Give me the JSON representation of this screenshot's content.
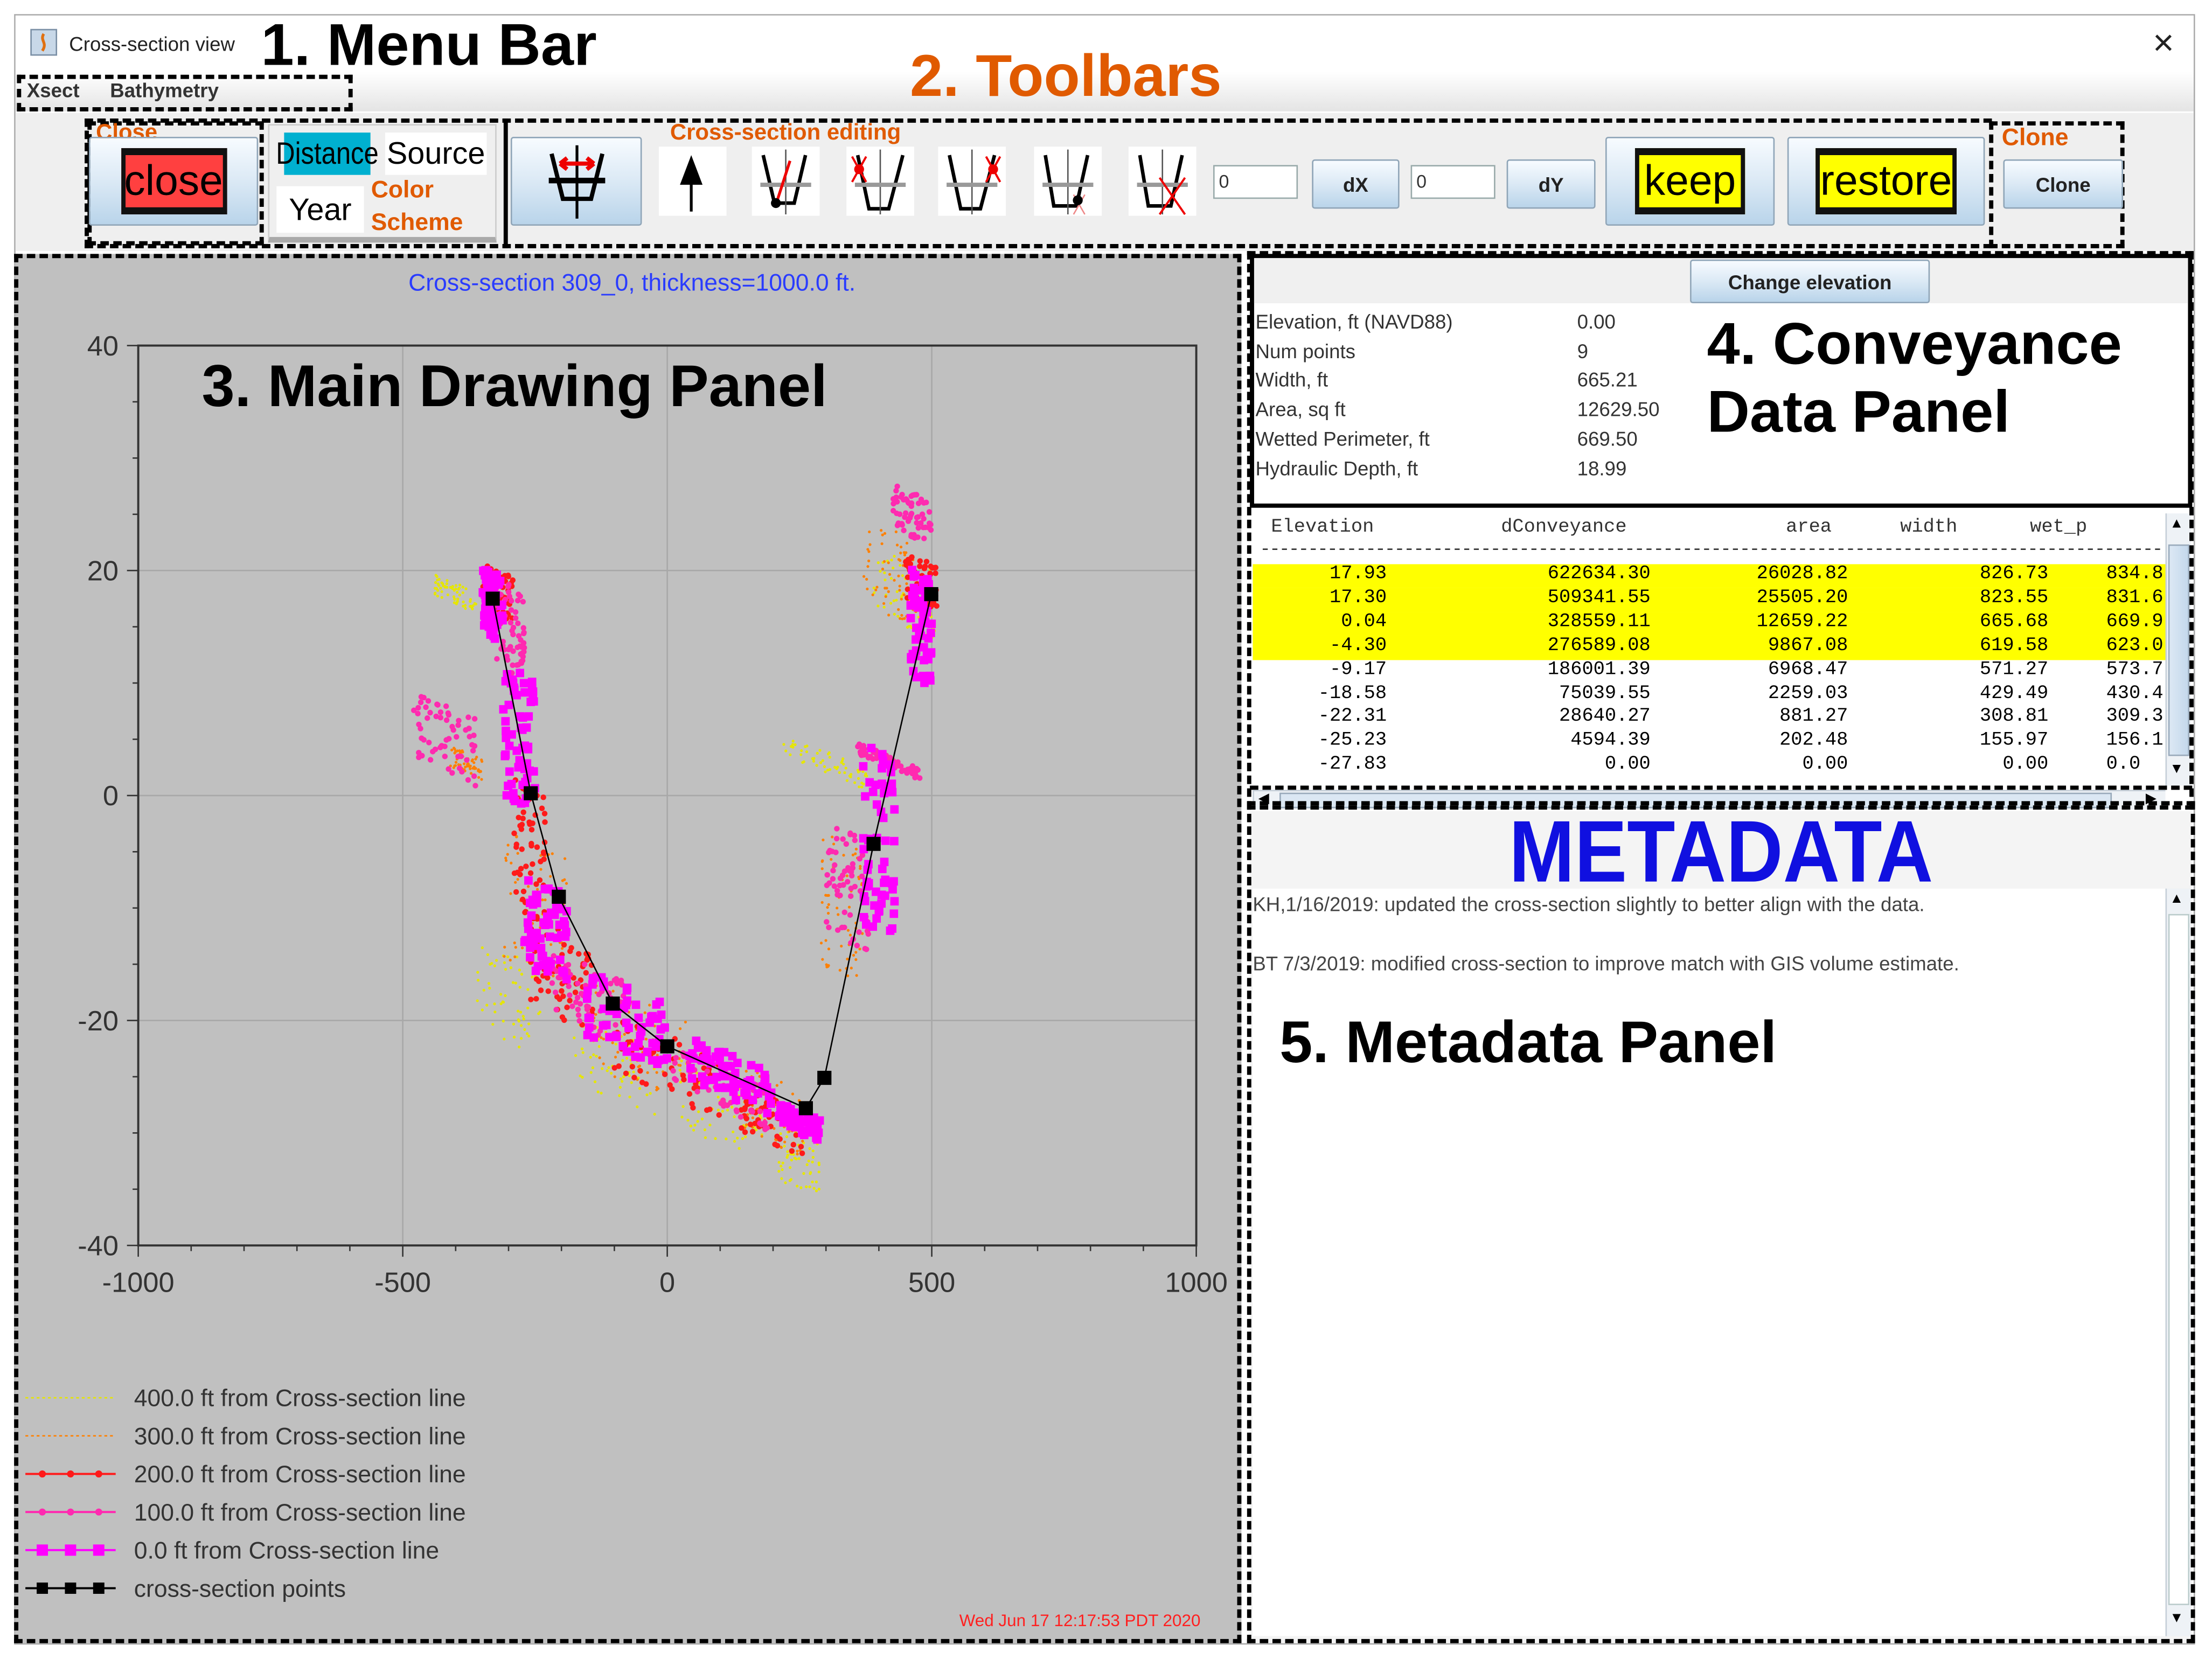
{
  "window": {
    "title": "Cross-section view",
    "close_glyph": "×"
  },
  "annotations": {
    "menu_bar": "1. Menu Bar",
    "toolbars": "2. Toolbars",
    "main_panel": "3. Main Drawing Panel",
    "conveyance_panel_1": "4. Conveyance",
    "conveyance_panel_2": "Data Panel",
    "metadata_panel": "5. Metadata Panel",
    "close_group": "Close",
    "color_scheme_1": "Color",
    "color_scheme_2": "Scheme",
    "editing_group": "Cross-section editing",
    "clone_group": "Clone"
  },
  "menu": {
    "items": [
      "Xsect",
      "Bathymetry"
    ]
  },
  "toolbar": {
    "close_label": "close",
    "color_distance": "Distance",
    "color_source": "Source",
    "color_year": "Year",
    "dx_value": "0",
    "dx_label": "dX",
    "dy_value": "0",
    "dy_label": "dY",
    "keep_label": "keep",
    "restore_label": "restore",
    "clone_label": "Clone",
    "edit_icons": [
      "move-up-icon",
      "move-point-icon",
      "delete-left-point-icon",
      "delete-right-point-icon",
      "insert-point-icon",
      "delete-point-icon"
    ]
  },
  "main": {
    "timestamp": "Wed Jun 17 12:17:53 PDT 2020"
  },
  "chart_data": {
    "type": "scatter",
    "title": "Cross-section 309_0, thickness=1000.0 ft.",
    "xlabel": "",
    "ylabel": "",
    "xlim": [
      -1000,
      1000
    ],
    "ylim": [
      -40,
      40
    ],
    "x_ticks": [
      "-1000",
      "-500",
      "0",
      "500",
      "1000"
    ],
    "y_ticks": [
      "40",
      "20",
      "0",
      "-20",
      "-40"
    ],
    "x_tick_values": [
      -1000,
      -500,
      0,
      500,
      1000
    ],
    "y_tick_values": [
      40,
      20,
      0,
      -20,
      -40
    ],
    "grid": true,
    "legend_placement": "bottom-left",
    "series": [
      {
        "name": "400.0 ft from Cross-section line",
        "color": "#e6e600",
        "marker": "dot",
        "clusters": [
          [
            -300,
            -18,
            60,
            4
          ],
          [
            -100,
            -24,
            80,
            3
          ],
          [
            100,
            -28,
            80,
            3
          ],
          [
            250,
            -32,
            40,
            3
          ],
          [
            450,
            18,
            60,
            3
          ],
          [
            300,
            3,
            80,
            1
          ],
          [
            -400,
            18,
            40,
            1
          ]
        ]
      },
      {
        "name": "300.0 ft from Cross-section line",
        "color": "#ff8000",
        "marker": "dot",
        "clusters": [
          [
            -250,
            -10,
            60,
            6
          ],
          [
            -50,
            -22,
            90,
            4
          ],
          [
            200,
            -28,
            60,
            3
          ],
          [
            330,
            -10,
            40,
            6
          ],
          [
            420,
            20,
            50,
            4
          ],
          [
            -380,
            3,
            30,
            1
          ]
        ]
      },
      {
        "name": "200.0 ft from Cross-section line",
        "color": "#ff1a1a",
        "marker": "circle",
        "clusters": [
          [
            -320,
            18,
            30,
            2
          ],
          [
            -260,
            -5,
            30,
            6
          ],
          [
            -200,
            -16,
            60,
            4
          ],
          [
            0,
            -24,
            100,
            3
          ],
          [
            200,
            -29,
            60,
            2
          ],
          [
            480,
            19,
            30,
            2
          ]
        ]
      },
      {
        "name": "100.0 ft from Cross-section line",
        "color": "#ff2ab0",
        "marker": "circle",
        "clusters": [
          [
            -420,
            5,
            60,
            3
          ],
          [
            -300,
            15,
            30,
            4
          ],
          [
            -150,
            -18,
            70,
            3
          ],
          [
            100,
            -26,
            90,
            2
          ],
          [
            340,
            -8,
            40,
            5
          ],
          [
            460,
            25,
            40,
            2
          ],
          [
            420,
            3,
            60,
            0.5
          ]
        ]
      },
      {
        "name": "0.0 ft from Cross-section line",
        "color": "#ff00ff",
        "marker": "square",
        "clusters": [
          [
            -330,
            17,
            20,
            3
          ],
          [
            -280,
            5,
            30,
            6
          ],
          [
            -230,
            -12,
            40,
            4
          ],
          [
            -80,
            -20,
            80,
            3
          ],
          [
            120,
            -25,
            80,
            2
          ],
          [
            250,
            -29,
            40,
            1
          ],
          [
            400,
            -4,
            30,
            8
          ],
          [
            480,
            15,
            20,
            5
          ]
        ]
      },
      {
        "name": "cross-section points",
        "color": "#000000",
        "marker": "line-square",
        "x": [
          -330,
          -258,
          -205,
          -103,
          0,
          262,
          297,
          390,
          499
        ],
        "y": [
          17.5,
          0.2,
          -9,
          -18.5,
          -22.3,
          -27.8,
          -25.1,
          -4.3,
          17.9
        ]
      }
    ]
  },
  "conveyance": {
    "change_elevation_label": "Change elevation",
    "summary": [
      {
        "label": "Elevation, ft (NAVD88)",
        "value": "0.00"
      },
      {
        "label": "Num points",
        "value": "9"
      },
      {
        "label": "Width, ft",
        "value": "665.21"
      },
      {
        "label": "Area, sq ft",
        "value": "12629.50"
      },
      {
        "label": "Wetted Perimeter, ft",
        "value": "669.50"
      },
      {
        "label": "Hydraulic Depth, ft",
        "value": "18.99"
      }
    ],
    "table": {
      "columns": [
        "Elevation",
        "dConveyance",
        "area",
        "width",
        "wet_p"
      ],
      "separator": "-----------------------------------------------------------------------------------------------",
      "highlight_color": "#ffff00",
      "rows": [
        {
          "hl": true,
          "cells": [
            "17.93",
            "622634.30",
            "26028.82",
            "826.73",
            "834.8"
          ]
        },
        {
          "hl": true,
          "cells": [
            "17.30",
            "509341.55",
            "25505.20",
            "823.55",
            "831.6"
          ]
        },
        {
          "hl": true,
          "cells": [
            "0.04",
            "328559.11",
            "12659.22",
            "665.68",
            "669.9"
          ]
        },
        {
          "hl": true,
          "cells": [
            "-4.30",
            "276589.08",
            "9867.08",
            "619.58",
            "623.0"
          ]
        },
        {
          "hl": false,
          "cells": [
            "-9.17",
            "186001.39",
            "6968.47",
            "571.27",
            "573.7"
          ]
        },
        {
          "hl": false,
          "cells": [
            "-18.58",
            "75039.55",
            "2259.03",
            "429.49",
            "430.4"
          ]
        },
        {
          "hl": false,
          "cells": [
            "-22.31",
            "28640.27",
            "881.27",
            "308.81",
            "309.3"
          ]
        },
        {
          "hl": false,
          "cells": [
            "-25.23",
            "4594.39",
            "202.48",
            "155.97",
            "156.1"
          ]
        },
        {
          "hl": false,
          "cells": [
            "-27.83",
            "0.00",
            "0.00",
            "0.00",
            "0.0"
          ]
        }
      ]
    }
  },
  "metadata": {
    "header": "METADATA",
    "lines": [
      "KH,1/16/2019: updated the cross-section slightly to better align with the data.",
      "BT 7/3/2019: modified cross-section to improve match with GIS volume estimate."
    ]
  }
}
